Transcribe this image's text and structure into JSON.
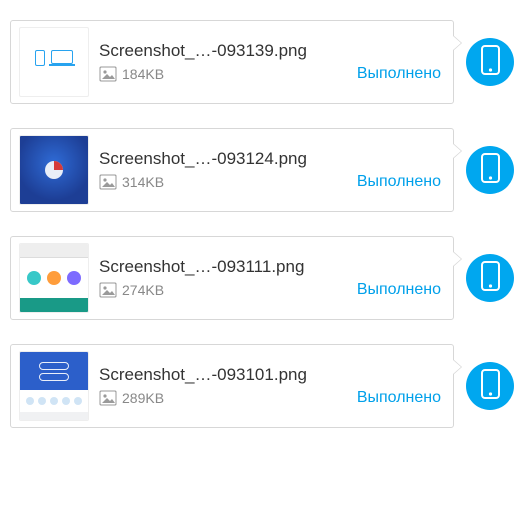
{
  "icons": {
    "badge": "phone-icon",
    "filetype": "image-icon"
  },
  "items": [
    {
      "filename": "Screenshot_…-093139.png",
      "size": "184KB",
      "status": "Выполнено",
      "thumb": "devices"
    },
    {
      "filename": "Screenshot_…-093124.png",
      "size": "314KB",
      "status": "Выполнено",
      "thumb": "bluegrad"
    },
    {
      "filename": "Screenshot_…-093111.png",
      "size": "274KB",
      "status": "Выполнено",
      "thumb": "panel1"
    },
    {
      "filename": "Screenshot_…-093101.png",
      "size": "289KB",
      "status": "Выполнено",
      "thumb": "panel2"
    }
  ]
}
